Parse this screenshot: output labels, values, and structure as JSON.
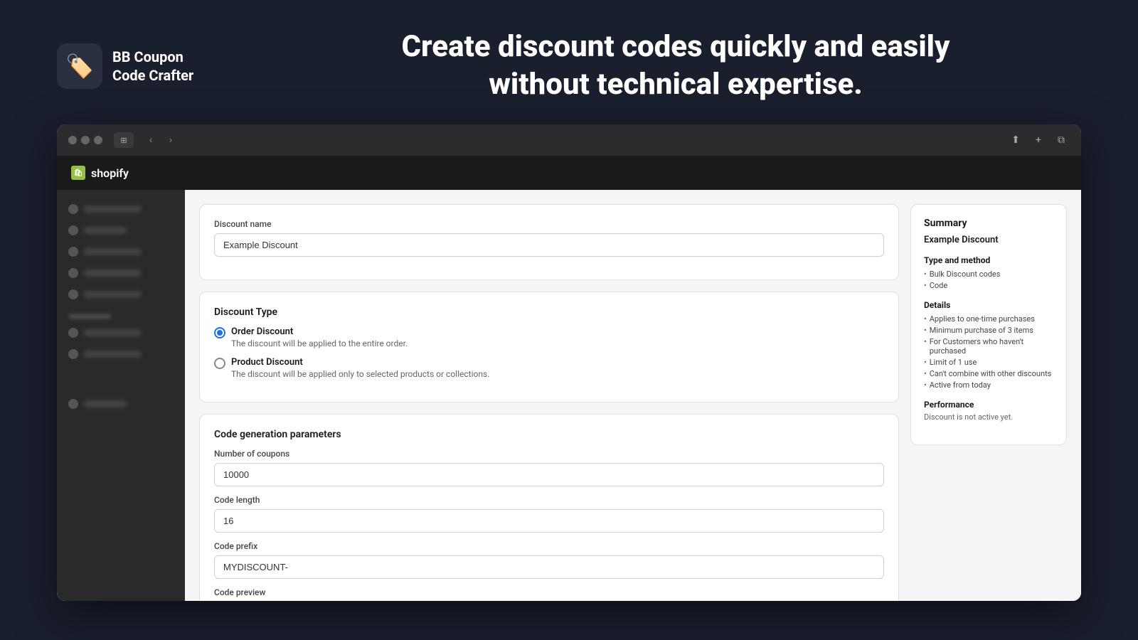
{
  "app": {
    "logo_icon": "🏷️",
    "logo_line1": "BB Coupon",
    "logo_line2": "Code Crafter",
    "hero_text_line1": "Create discount codes quickly and easily",
    "hero_text_line2": "without technical expertise."
  },
  "browser": {
    "nav_back": "‹",
    "nav_forward": "›",
    "tab_icon": "⊞",
    "share_icon": "⬆",
    "new_tab_icon": "+",
    "copy_icon": "⧉"
  },
  "shopify": {
    "brand": "shopify"
  },
  "sidebar": {
    "items": [
      {
        "label": ""
      },
      {
        "label": ""
      },
      {
        "label": ""
      },
      {
        "label": ""
      },
      {
        "label": ""
      }
    ],
    "section_items": [
      {
        "label": ""
      },
      {
        "label": ""
      }
    ],
    "footer_item": {
      "label": ""
    }
  },
  "form": {
    "discount_name_label": "Discount name",
    "discount_name_placeholder": "Example Discount",
    "discount_name_value": "Example Discount",
    "discount_type_label": "Discount Type",
    "order_discount_label": "Order Discount",
    "order_discount_desc": "The discount will be applied to the entire order.",
    "product_discount_label": "Product Discount",
    "product_discount_desc": "The discount will be applied only to selected products or collections.",
    "code_gen_title": "Code generation parameters",
    "num_coupons_label": "Number of coupons",
    "num_coupons_value": "10000",
    "code_length_label": "Code length",
    "code_length_value": "16",
    "code_prefix_label": "Code prefix",
    "code_prefix_value": "MYDISCOUNT-",
    "code_preview_label": "Code preview"
  },
  "summary": {
    "title": "Summary",
    "discount_name": "Example Discount",
    "type_method_title": "Type and method",
    "type_method_items": [
      "Bulk Discount codes",
      "Code"
    ],
    "details_title": "Details",
    "details_items": [
      "Applies to one-time purchases",
      "Minimum purchase of 3 items",
      "For Customers who haven't purchased",
      "Limit of 1 use",
      "Can't combine with other discounts",
      "Active from today"
    ],
    "performance_title": "Performance",
    "performance_text": "Discount is not active yet."
  }
}
